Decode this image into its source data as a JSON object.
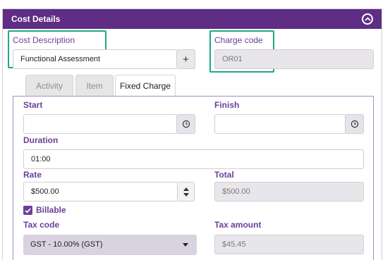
{
  "panel": {
    "title": "Cost Details",
    "collapse_icon": "chevron-up-circle-icon"
  },
  "cost_description": {
    "label": "Cost Description",
    "value": "Functional Assessment",
    "add_label": "+"
  },
  "charge_code": {
    "label": "Charge code",
    "value": "OR01"
  },
  "tabs": [
    {
      "label": "Activity",
      "active": false
    },
    {
      "label": "Item",
      "active": false
    },
    {
      "label": "Fixed Charge",
      "active": true
    }
  ],
  "start": {
    "label": "Start",
    "value": ""
  },
  "finish": {
    "label": "Finish",
    "value": ""
  },
  "duration": {
    "label": "Duration",
    "value": "01:00"
  },
  "rate": {
    "label": "Rate",
    "value": "$500.00"
  },
  "total": {
    "label": "Total",
    "value": "$500.00"
  },
  "billable": {
    "label": "Billable",
    "checked": true
  },
  "tax_code": {
    "label": "Tax code",
    "value": "GST - 10.00% (GST)"
  },
  "tax_amount": {
    "label": "Tax amount",
    "value": "$45.45"
  },
  "colors": {
    "header": "#5f2d84",
    "label": "#6b3f99",
    "highlight": "#1fa786"
  }
}
